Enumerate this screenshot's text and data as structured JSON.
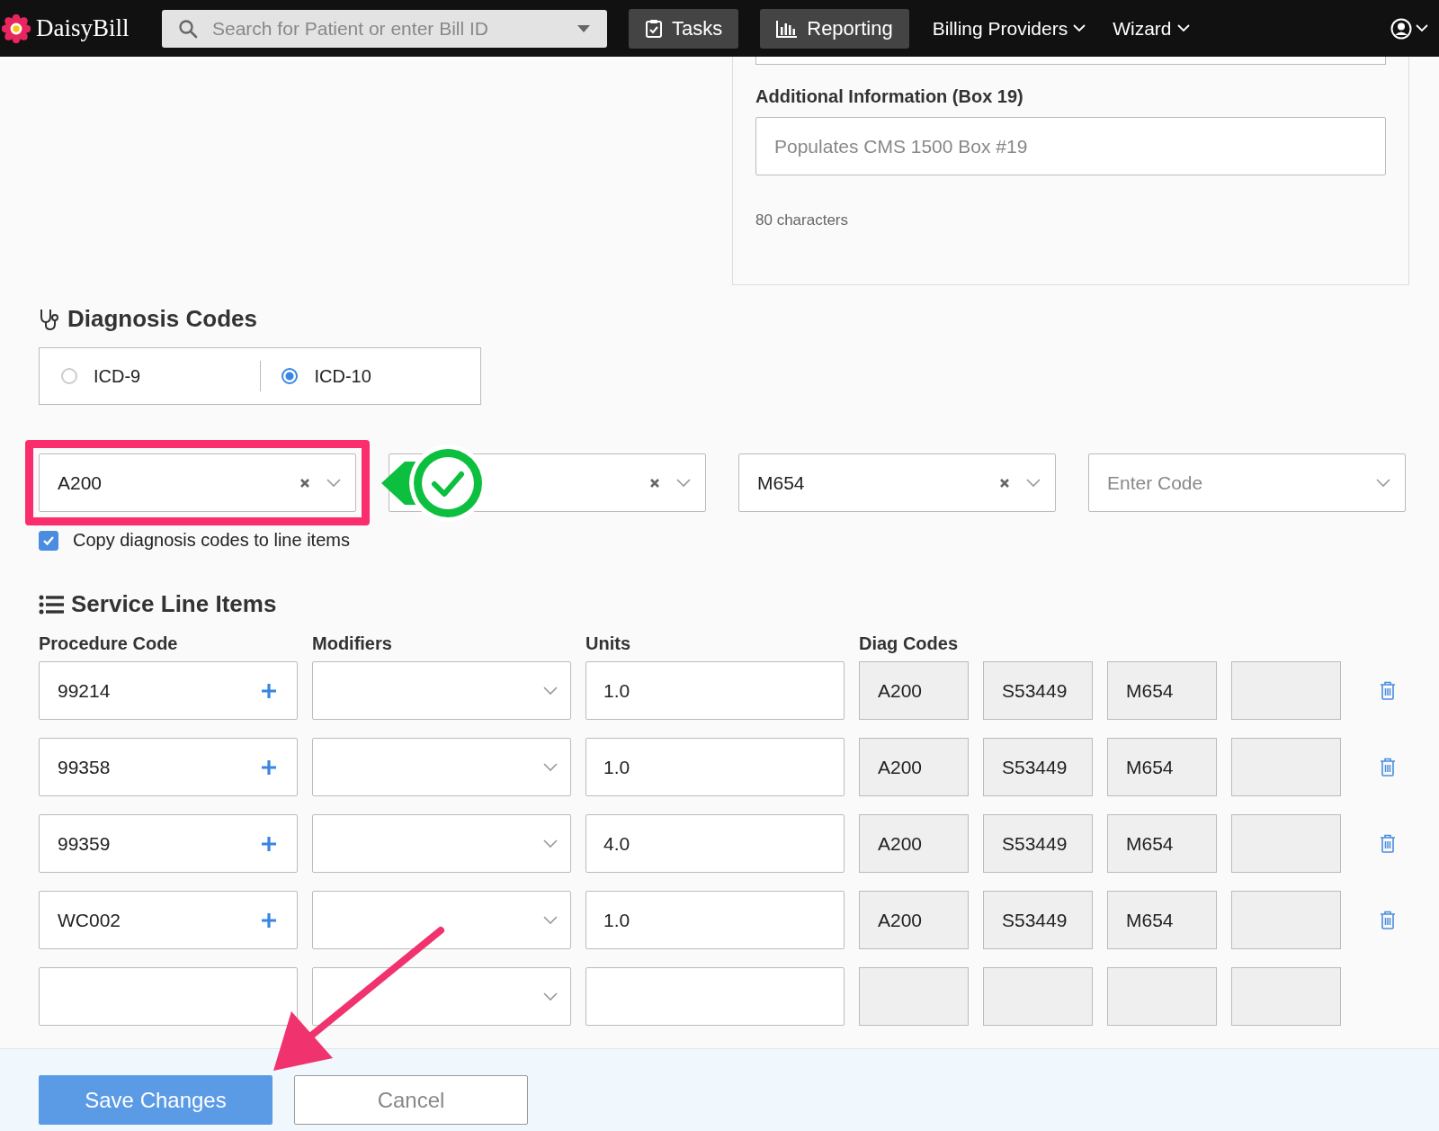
{
  "nav": {
    "brand": "DaisyBill",
    "search": {
      "placeholder": "Search for Patient or enter Bill ID"
    },
    "buttons": [
      {
        "label": "Tasks",
        "kind": "tasks"
      },
      {
        "label": "Reporting",
        "kind": "reporting"
      }
    ],
    "menus": [
      "Billing Providers",
      "Wizard"
    ]
  },
  "additional_info": {
    "label": "Additional Information (Box 19)",
    "placeholder": "Populates CMS 1500 Box #19",
    "hint": "80 characters"
  },
  "diagnosis": {
    "title": "Diagnosis Codes",
    "code_sets": [
      {
        "label": "ICD-9",
        "selected": false
      },
      {
        "label": "ICD-10",
        "selected": true
      }
    ],
    "fields": [
      {
        "value": "A200",
        "clearable": true,
        "highlighted": true
      },
      {
        "clearable": true,
        "highlighted": false
      },
      {
        "value": "M654",
        "clearable": true,
        "highlighted": false
      },
      {
        "placeholder": "Enter Code",
        "clearable": false,
        "highlighted": false
      }
    ],
    "copy_to_lines": {
      "label": "Copy diagnosis codes to line items",
      "checked": true
    }
  },
  "service_lines": {
    "title": "Service Line Items",
    "columns": [
      "Procedure Code",
      "Modifiers",
      "Units",
      "Diag Codes"
    ],
    "rows": [
      {
        "kind": "entry",
        "procedure_code": "99214",
        "units": "1.0",
        "diag_codes": [
          "A200",
          "S53449",
          "M654"
        ]
      },
      {
        "kind": "entry",
        "procedure_code": "99358",
        "units": "1.0",
        "diag_codes": [
          "A200",
          "S53449",
          "M654"
        ]
      },
      {
        "kind": "entry",
        "procedure_code": "99359",
        "units": "4.0",
        "diag_codes": [
          "A200",
          "S53449",
          "M654"
        ]
      },
      {
        "kind": "entry",
        "procedure_code": "WC002",
        "units": "1.0",
        "diag_codes": [
          "A200",
          "S53449",
          "M654"
        ]
      },
      {
        "kind": "blank"
      }
    ]
  },
  "footer": {
    "primary": "Save Changes",
    "secondary": "Cancel"
  }
}
